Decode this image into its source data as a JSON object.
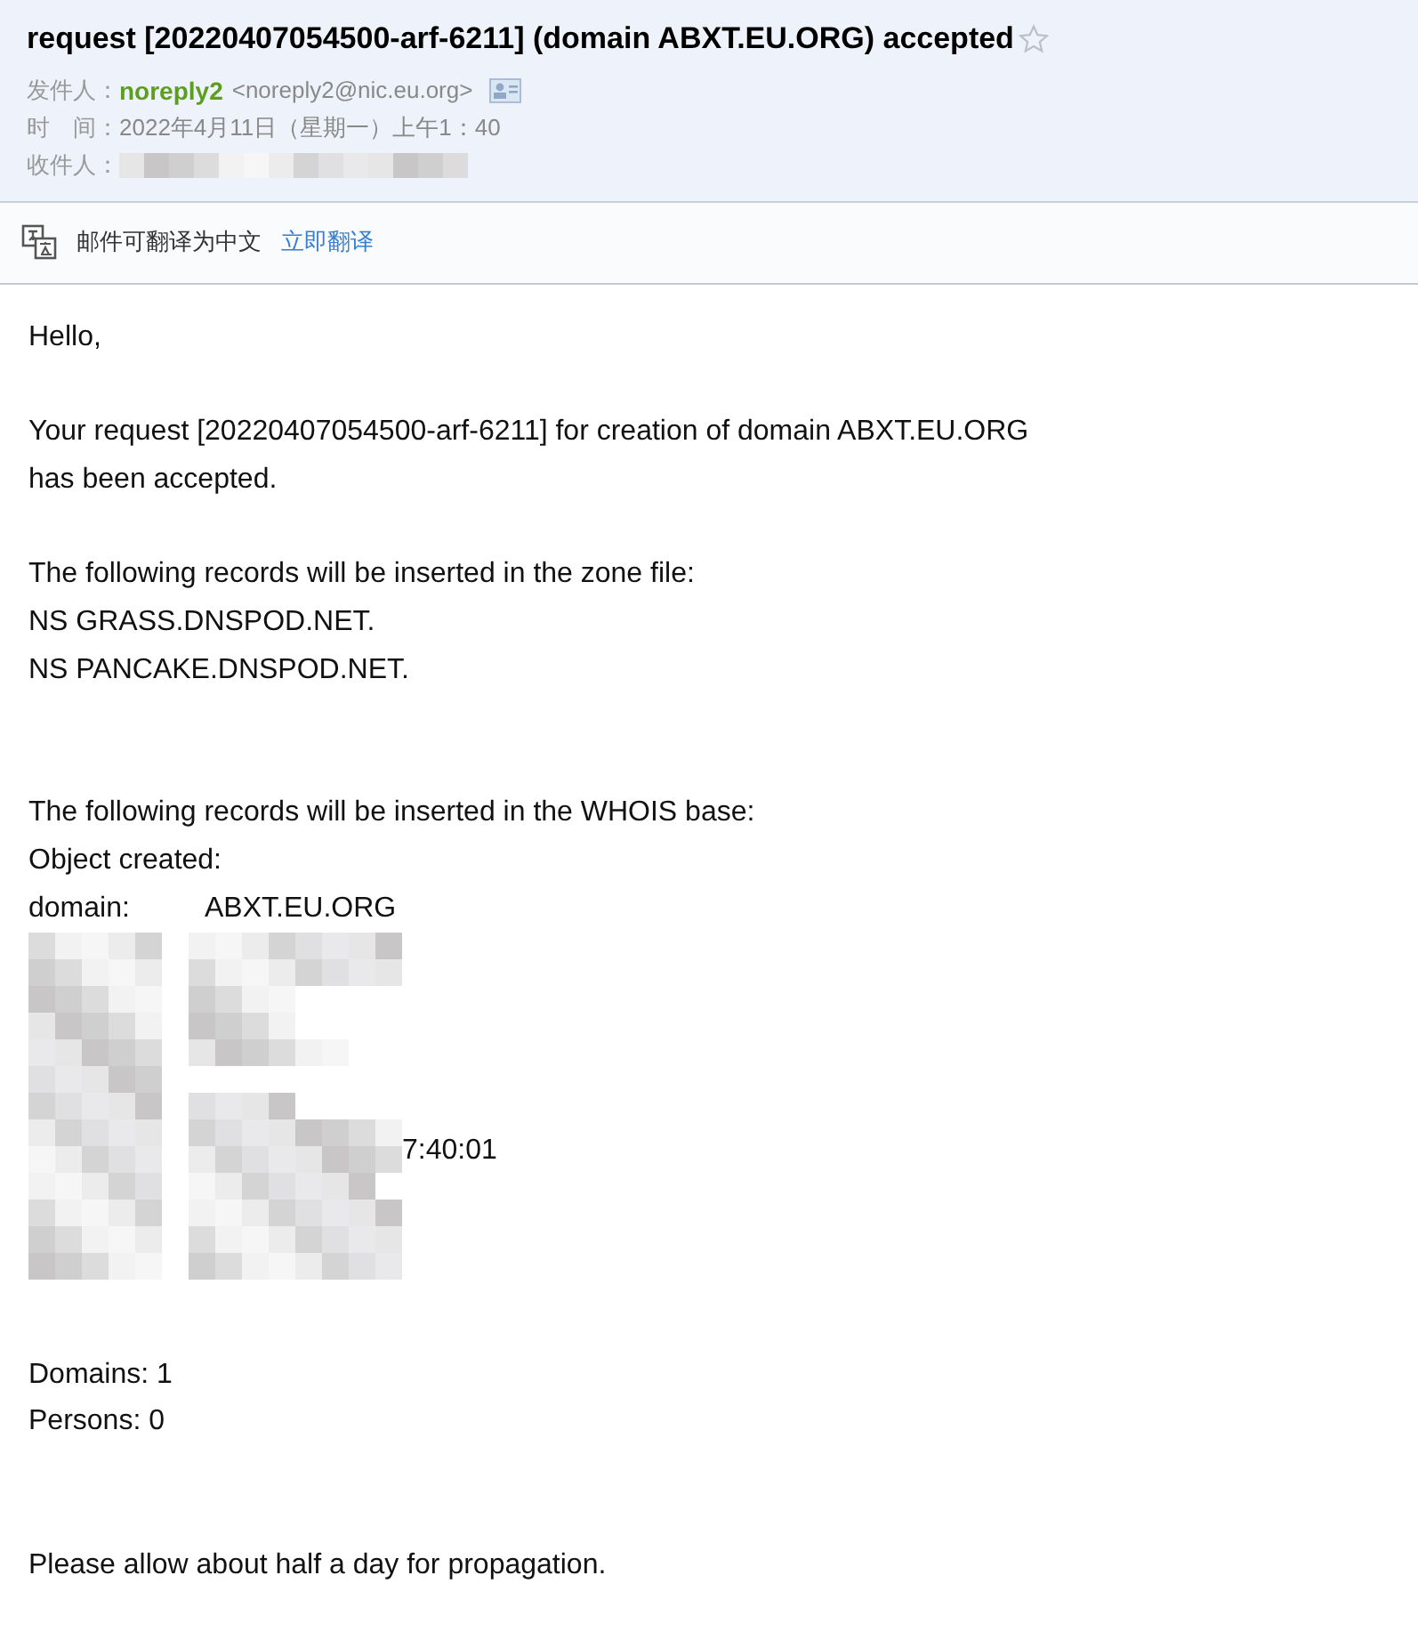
{
  "header": {
    "subject": "request [20220407054500-arf-6211] (domain ABXT.EU.ORG) accepted",
    "starred": false,
    "sender_label": "发件人：",
    "sender_name": "noreply2",
    "sender_address": "<noreply2@nic.eu.org>",
    "time_label": "时　间：",
    "time_value": "2022年4月11日（星期一）上午1：40",
    "recipient_label": "收件人："
  },
  "translate_bar": {
    "text": "邮件可翻译为中文",
    "link": "立即翻译"
  },
  "body": [
    {
      "kind": "line",
      "text": "Hello,"
    },
    {
      "kind": "blank"
    },
    {
      "kind": "line",
      "text": "Your request [20220407054500-arf-6211] for creation of domain ABXT.EU.ORG"
    },
    {
      "kind": "line",
      "text": "has been accepted."
    },
    {
      "kind": "blank"
    },
    {
      "kind": "line",
      "text": "The following records will be inserted in the zone file:"
    },
    {
      "kind": "line",
      "text": "NS GRASS.DNSPOD.NET."
    },
    {
      "kind": "line",
      "text": "NS PANCAKE.DNSPOD.NET."
    },
    {
      "kind": "blank"
    },
    {
      "kind": "blank"
    },
    {
      "kind": "line",
      "text": "The following records will be inserted in the WHOIS base:"
    },
    {
      "kind": "line",
      "text": "Object created:"
    },
    {
      "kind": "field",
      "label": "domain:",
      "value": "ABXT.EU.ORG"
    },
    {
      "kind": "redacted",
      "visible_text": "7:40:01"
    },
    {
      "kind": "blank"
    },
    {
      "kind": "line",
      "text": "Domains: 1"
    },
    {
      "kind": "line",
      "text": "Persons: 0"
    },
    {
      "kind": "blank"
    },
    {
      "kind": "blank"
    },
    {
      "kind": "line",
      "text": "Please allow about half a day for propagation."
    }
  ]
}
